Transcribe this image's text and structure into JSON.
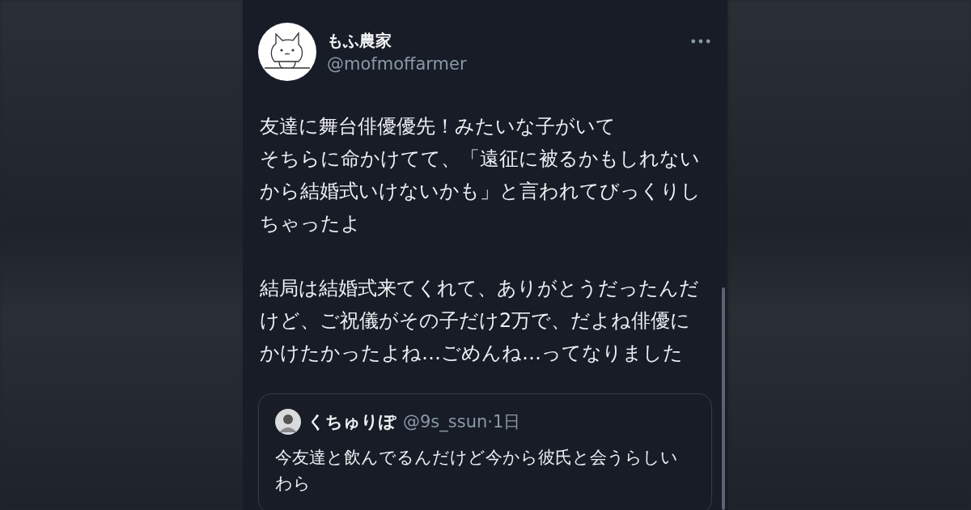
{
  "author": {
    "name": "もふ農家",
    "handle": "@mofmoffarmer"
  },
  "paragraphs": [
    {
      "lines": [
        "友達に舞台俳優優先！みたいな子がいて",
        "そちらに命かけてて、「遠征に被るかもしれないから結婚式いけないかも」と言われてびっくりしちゃったよ"
      ]
    },
    {
      "lines": [
        "結局は結婚式来てくれて、ありがとうだったんだけど、ご祝儀がその子だけ2万で、だよね俳優にかけたかったよね…ごめんね…ってなりました"
      ]
    }
  ],
  "quote": {
    "name": "くちゅりぽ",
    "handle": "@9s_ssun",
    "time": "·1日",
    "text": "今友達と飲んでるんだけど今から彼氏と会うらしいわら"
  }
}
